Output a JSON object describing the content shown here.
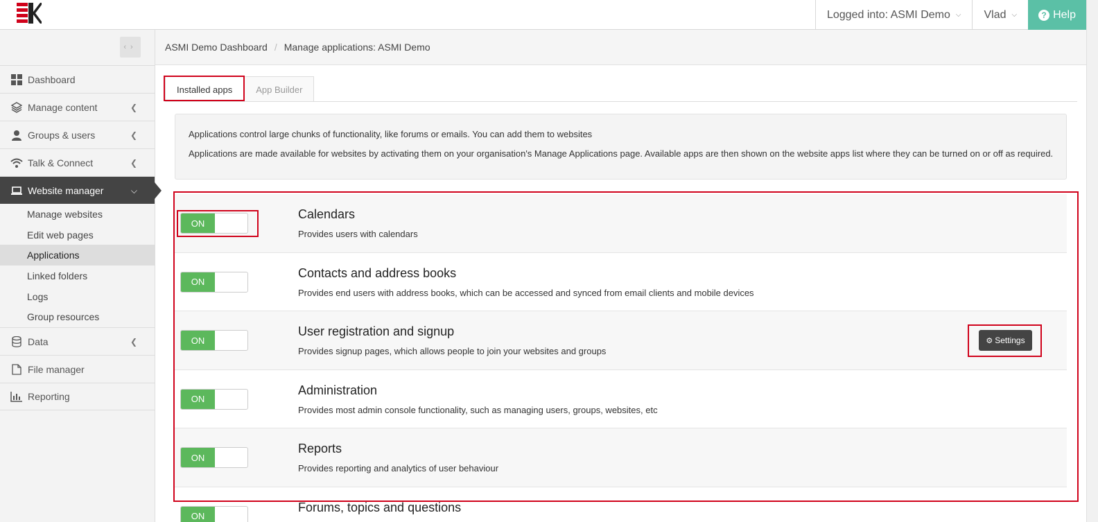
{
  "topbar": {
    "logged_into": "Logged into: ASMI Demo",
    "user": "Vlad",
    "help": "Help"
  },
  "sidebar": {
    "items": [
      {
        "label": "Dashboard",
        "icon": "dashboard-grid-icon"
      },
      {
        "label": "Manage content",
        "icon": "layers-icon"
      },
      {
        "label": "Groups & users",
        "icon": "user-icon"
      },
      {
        "label": "Talk & Connect",
        "icon": "wifi-icon"
      },
      {
        "label": "Website manager",
        "icon": "laptop-icon"
      },
      {
        "label": "Data",
        "icon": "database-icon"
      },
      {
        "label": "File manager",
        "icon": "file-icon"
      },
      {
        "label": "Reporting",
        "icon": "bar-chart-icon"
      }
    ],
    "sub_items": [
      "Manage websites",
      "Edit web pages",
      "Applications",
      "Linked folders",
      "Logs",
      "Group resources"
    ],
    "selected_sub_item": "Applications"
  },
  "breadcrumb": {
    "home": "ASMI Demo Dashboard",
    "current": "Manage applications: ASMI Demo"
  },
  "tabs": [
    "Installed apps",
    "App Builder"
  ],
  "info": {
    "line1": "Applications control large chunks of functionality, like forums or emails. You can add them to websites",
    "line2": "Applications are made available for websites by activating them on your organisation's Manage Applications page. Available apps are then shown on the website apps list where they can be turned on or off as required."
  },
  "apps": [
    {
      "title": "Calendars",
      "desc": "Provides users with calendars",
      "state": "ON"
    },
    {
      "title": "Contacts and address books",
      "desc": "Provides end users with address books, which can be accessed and synced from email clients and mobile devices",
      "state": "ON"
    },
    {
      "title": "User registration and signup",
      "desc": "Provides signup pages, which allows people to join your websites and groups",
      "state": "ON"
    },
    {
      "title": "Administration",
      "desc": "Provides most admin console functionality, such as managing users, groups, websites, etc",
      "state": "ON"
    },
    {
      "title": "Reports",
      "desc": "Provides reporting and analytics of user behaviour",
      "state": "ON"
    },
    {
      "title": "Forums, topics and questions",
      "desc": "",
      "state": "ON"
    }
  ],
  "settings_button": "Settings",
  "colors": {
    "accent_help": "#5bc0a6",
    "toggle_on": "#5cb85c",
    "highlight": "#d0021b",
    "active_nav": "#444444"
  }
}
